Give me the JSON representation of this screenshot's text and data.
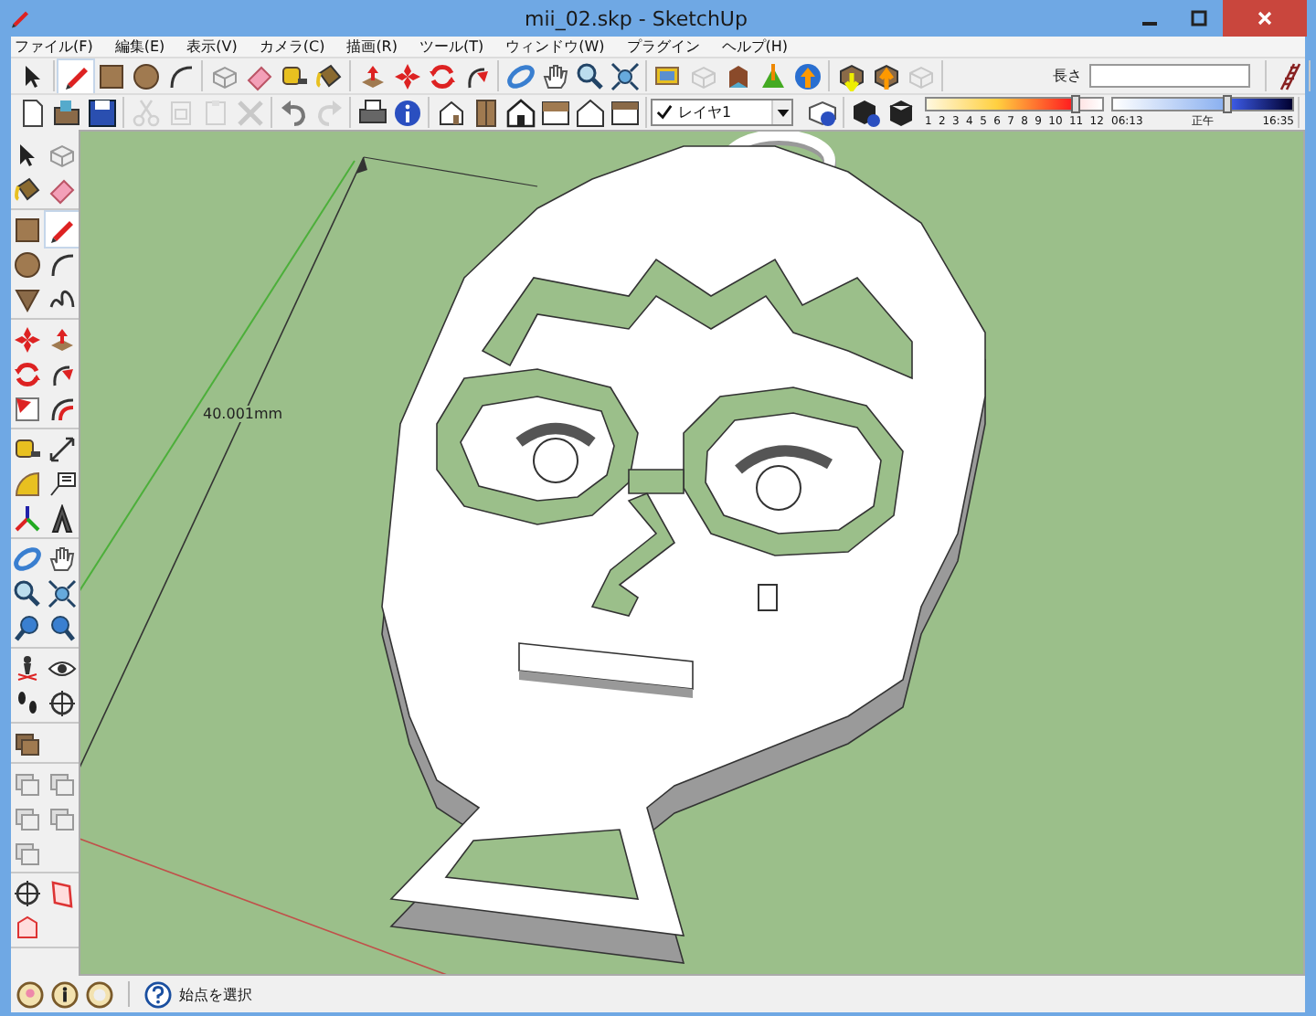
{
  "window": {
    "title": "mii_02.skp - SketchUp"
  },
  "menu": [
    "ファイル(F)",
    "編集(E)",
    "表示(V)",
    "カメラ(C)",
    "描画(R)",
    "ツール(T)",
    "ウィンドウ(W)",
    "プラグイン",
    "ヘルプ(H)"
  ],
  "toolbar_row_1": [
    [
      {
        "kind": "select",
        "selected": false,
        "disabled": false
      }
    ],
    [
      {
        "kind": "pencil",
        "selected": true,
        "disabled": false
      },
      {
        "kind": "rectangle",
        "selected": false,
        "disabled": false
      },
      {
        "kind": "circle",
        "selected": false,
        "disabled": false
      },
      {
        "kind": "arc",
        "selected": false,
        "disabled": false
      }
    ],
    [
      {
        "kind": "component",
        "selected": false,
        "disabled": false
      },
      {
        "kind": "eraser",
        "selected": false,
        "disabled": false
      },
      {
        "kind": "tape",
        "selected": false,
        "disabled": false
      },
      {
        "kind": "paint",
        "selected": false,
        "disabled": false
      }
    ],
    [
      {
        "kind": "pushpull",
        "selected": false,
        "disabled": false
      },
      {
        "kind": "move",
        "selected": false,
        "disabled": false
      },
      {
        "kind": "rotate",
        "selected": false,
        "disabled": false
      },
      {
        "kind": "followme",
        "selected": false,
        "disabled": false
      }
    ],
    [
      {
        "kind": "orbit",
        "selected": false,
        "disabled": false
      },
      {
        "kind": "pan",
        "selected": false,
        "disabled": false
      },
      {
        "kind": "zoom",
        "selected": false,
        "disabled": false
      },
      {
        "kind": "zoomext",
        "selected": false,
        "disabled": false
      }
    ],
    [
      {
        "kind": "photo",
        "selected": false,
        "disabled": false
      },
      {
        "kind": "component",
        "selected": false,
        "disabled": true
      },
      {
        "kind": "warehouse",
        "selected": false,
        "disabled": false
      },
      {
        "kind": "terrain",
        "selected": false,
        "disabled": false
      },
      {
        "kind": "globe",
        "selected": false,
        "disabled": false
      }
    ],
    [
      {
        "kind": "download",
        "selected": false,
        "disabled": false
      },
      {
        "kind": "upload",
        "selected": false,
        "disabled": false
      },
      {
        "kind": "component",
        "selected": false,
        "disabled": true
      }
    ]
  ],
  "measurements": {
    "label": "長さ"
  },
  "toolbar_row_2": [
    [
      {
        "kind": "new",
        "disabled": false
      },
      {
        "kind": "open",
        "disabled": false
      },
      {
        "kind": "save",
        "disabled": false
      }
    ],
    [
      {
        "kind": "cut",
        "disabled": true
      },
      {
        "kind": "copy",
        "disabled": true
      },
      {
        "kind": "paste",
        "disabled": true
      },
      {
        "kind": "delete",
        "disabled": true
      }
    ],
    [
      {
        "kind": "undo",
        "disabled": false
      },
      {
        "kind": "redo",
        "disabled": true
      }
    ],
    [
      {
        "kind": "print",
        "disabled": false
      },
      {
        "kind": "info",
        "disabled": false
      }
    ],
    [
      {
        "kind": "iso",
        "disabled": false
      },
      {
        "kind": "door",
        "disabled": false
      },
      {
        "kind": "house",
        "disabled": false
      },
      {
        "kind": "houseback",
        "disabled": false
      },
      {
        "kind": "houseoutline",
        "disabled": false
      },
      {
        "kind": "plan",
        "disabled": false
      }
    ]
  ],
  "layer": {
    "name": "レイヤ1",
    "current": true
  },
  "shadows": {
    "month_labels": [
      "1",
      "2",
      "3",
      "4",
      "5",
      "6",
      "7",
      "8",
      "9",
      "10",
      "11",
      "12"
    ],
    "month_slider": {
      "level": 0.84
    },
    "time_start": "06:13",
    "time_mid": "正午",
    "time_end": "16:35",
    "time_slider": {
      "level": 0.63
    }
  },
  "left_toolbar": [
    [
      {
        "kind": "select",
        "selected": false
      },
      {
        "kind": "component",
        "selected": false
      },
      {
        "kind": "paint",
        "selected": false
      },
      {
        "kind": "eraser",
        "selected": false
      }
    ],
    [
      {
        "kind": "rectangle",
        "selected": false
      },
      {
        "kind": "pencil",
        "selected": true
      },
      {
        "kind": "circle",
        "selected": false
      },
      {
        "kind": "arc",
        "selected": false
      },
      {
        "kind": "polygon",
        "selected": false
      },
      {
        "kind": "freehand",
        "selected": false
      }
    ],
    [
      {
        "kind": "move",
        "selected": false
      },
      {
        "kind": "pushpull",
        "selected": false
      },
      {
        "kind": "rotate",
        "selected": false
      },
      {
        "kind": "followme",
        "selected": false
      },
      {
        "kind": "scale",
        "selected": false
      },
      {
        "kind": "offset",
        "selected": false
      }
    ],
    [
      {
        "kind": "tape",
        "selected": false
      },
      {
        "kind": "dimension",
        "selected": false
      },
      {
        "kind": "protractor",
        "selected": false
      },
      {
        "kind": "text",
        "selected": false
      },
      {
        "kind": "axes",
        "selected": false
      },
      {
        "kind": "text3d",
        "selected": false
      }
    ],
    [
      {
        "kind": "orbit",
        "selected": false
      },
      {
        "kind": "pan",
        "selected": false
      },
      {
        "kind": "zoom",
        "selected": false
      },
      {
        "kind": "zoomext",
        "selected": false
      },
      {
        "kind": "prev",
        "selected": false
      },
      {
        "kind": "next",
        "selected": false
      }
    ],
    [
      {
        "kind": "position",
        "selected": false
      },
      {
        "kind": "look",
        "selected": false
      },
      {
        "kind": "walk",
        "selected": false
      },
      {
        "kind": "section",
        "selected": false
      }
    ],
    [
      {
        "kind": "solid",
        "selected": false
      }
    ],
    [
      {
        "kind": "solidgray",
        "selected": false
      },
      {
        "kind": "solidgray",
        "selected": false
      },
      {
        "kind": "solidgray",
        "selected": false
      },
      {
        "kind": "solidgray",
        "selected": false
      },
      {
        "kind": "solidgray",
        "selected": false
      }
    ],
    [
      {
        "kind": "section",
        "selected": false
      },
      {
        "kind": "sectionplane",
        "selected": false
      },
      {
        "kind": "sectionfill",
        "selected": false
      }
    ]
  ],
  "viewport": {
    "dimension": "40.001mm"
  },
  "status_bar": {
    "text": "始点を選択"
  }
}
